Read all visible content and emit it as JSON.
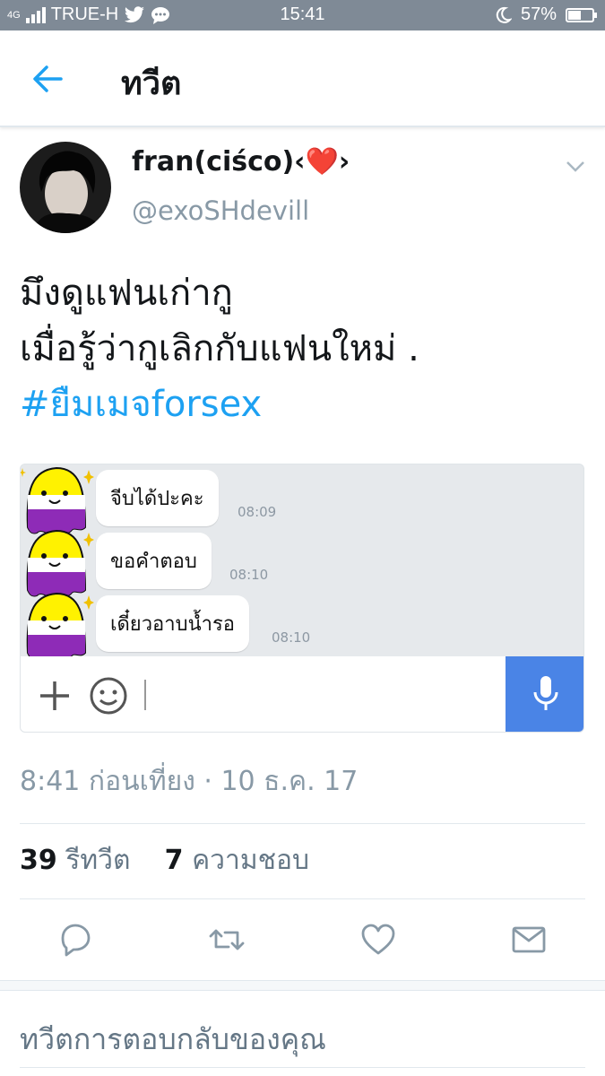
{
  "status_bar": {
    "network": "TRUE-H",
    "signal": "4G",
    "time": "15:41",
    "battery_percent": "57%",
    "battery_level": 0.57
  },
  "header": {
    "title": "ทวีต"
  },
  "tweet": {
    "display_name": "fran(ciśco)‹❤️›",
    "handle": "@exoSHdevill",
    "text_line1": "มึงดูแฟนเก่ากู",
    "text_line2": "เมื่อรู้ว่ากูเลิกกับแฟนใหม่ .",
    "hashtag": "#ยืมเมจforsex",
    "timestamp": "8:41 ก่อนเที่ยง · 10 ธ.ค. 17",
    "retweets_count": "39",
    "retweets_label": "รีทวีต",
    "likes_count": "7",
    "likes_label": "ความชอบ"
  },
  "chat": {
    "messages": [
      {
        "text": "จีบได้ปะคะ",
        "time": "08:09"
      },
      {
        "text": "ขอคำตอบ",
        "time": "08:10"
      },
      {
        "text": "เดี๋ยวอาบน้ำรอ",
        "time": "08:10"
      }
    ]
  },
  "reply": {
    "placeholder": "ทวีตการตอบกลับของคุณ"
  },
  "colors": {
    "accent": "#1da1f2",
    "status_bar": "#7f8a96",
    "mic": "#4a84e6"
  }
}
